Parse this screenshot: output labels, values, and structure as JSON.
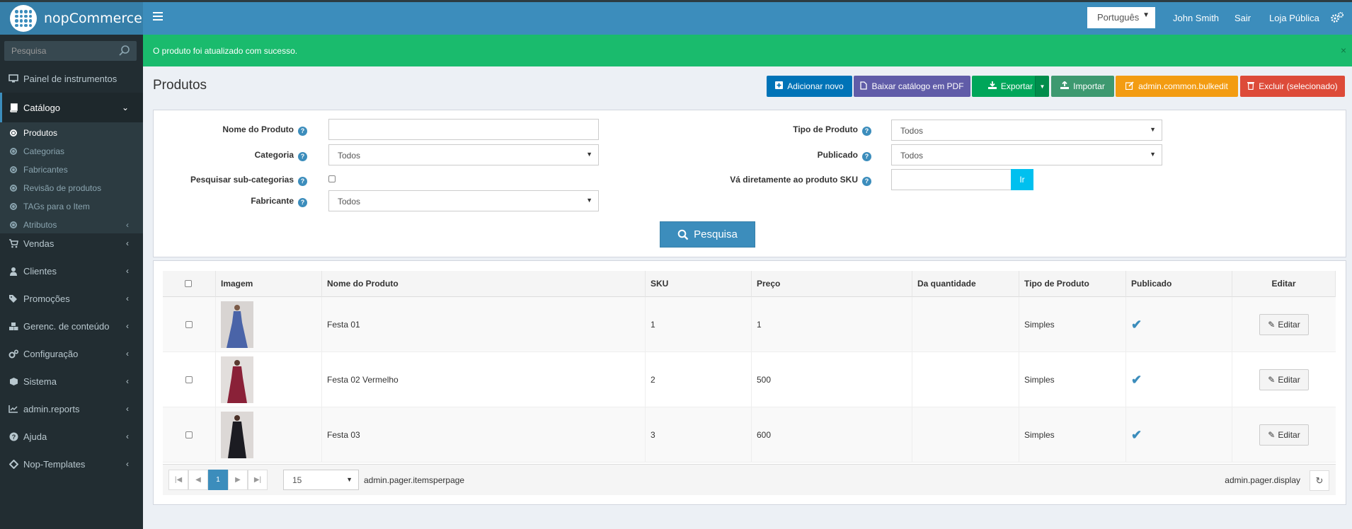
{
  "app": {
    "name": "nopCommerce"
  },
  "topbar": {
    "language": "Português",
    "user": "John Smith",
    "logout": "Sair",
    "store": "Loja Pública"
  },
  "sidebar": {
    "search_placeholder": "Pesquisa",
    "items": [
      {
        "label": "Painel de instrumentos",
        "icon": "desktop-icon"
      },
      {
        "label": "Catálogo",
        "icon": "book-icon"
      },
      {
        "label": "Vendas",
        "icon": "cart-icon"
      },
      {
        "label": "Clientes",
        "icon": "user-icon"
      },
      {
        "label": "Promoções",
        "icon": "tags-icon"
      },
      {
        "label": "Gerenc. de conteúdo",
        "icon": "cubes-icon"
      },
      {
        "label": "Configuração",
        "icon": "gears-icon"
      },
      {
        "label": "Sistema",
        "icon": "cube-icon"
      },
      {
        "label": "admin.reports",
        "icon": "line-chart-icon"
      },
      {
        "label": "Ajuda",
        "icon": "question-icon"
      },
      {
        "label": "Nop-Templates",
        "icon": "puzzle-icon"
      }
    ],
    "catalog_sub": [
      {
        "label": "Produtos"
      },
      {
        "label": "Categorias"
      },
      {
        "label": "Fabricantes"
      },
      {
        "label": "Revisão de produtos"
      },
      {
        "label": "TAGs para o Item"
      },
      {
        "label": "Atributos"
      }
    ]
  },
  "alert": {
    "message": "O produto foi atualizado com sucesso.",
    "close": "×"
  },
  "page": {
    "title": "Produtos"
  },
  "toolbar": {
    "add_new": "Adicionar novo",
    "download_pdf": "Baixar catálogo em PDF",
    "export": "Exportar",
    "import": "Importar",
    "bulkedit": "admin.common.bulkedit",
    "delete_selected": "Excluir (selecionado)"
  },
  "colors": {
    "primary": "#3c8dbc",
    "purple": "#605ca8",
    "green": "#00a65a",
    "teal": "#3d9970",
    "orange": "#f39c12",
    "red": "#dd4b39",
    "alert_green": "#1abb6d"
  },
  "filters": {
    "product_name_label": "Nome do Produto",
    "product_name_value": "",
    "category_label": "Categoria",
    "category_value": "Todos",
    "search_subcategories_label": "Pesquisar sub-categorias",
    "manufacturer_label": "Fabricante",
    "manufacturer_value": "Todos",
    "product_type_label": "Tipo de Produto",
    "product_type_value": "Todos",
    "published_label": "Publicado",
    "published_value": "Todos",
    "goto_sku_label": "Vá diretamente ao produto SKU",
    "goto_sku_value": "",
    "go_button": "Ir",
    "search_button": "Pesquisa"
  },
  "table": {
    "columns": [
      "Imagem",
      "Nome do Produto",
      "SKU",
      "Preço",
      "Da quantidade",
      "Tipo de Produto",
      "Publicado",
      "Editar"
    ],
    "rows": [
      {
        "name": "Festa 01",
        "sku": "1",
        "price": "1",
        "quantity": "",
        "type": "Simples",
        "published": true,
        "edit": "Editar",
        "dress_color": "#4a64a8"
      },
      {
        "name": "Festa 02 Vermelho",
        "sku": "2",
        "price": "500",
        "quantity": "",
        "type": "Simples",
        "published": true,
        "edit": "Editar",
        "dress_color": "#8a2138"
      },
      {
        "name": "Festa 03",
        "sku": "3",
        "price": "600",
        "quantity": "",
        "type": "Simples",
        "published": true,
        "edit": "Editar",
        "dress_color": "#1c1c22"
      }
    ]
  },
  "pager": {
    "current_page": "1",
    "items_per_page": "15",
    "items_per_page_label": "admin.pager.itemsperpage",
    "display": "admin.pager.display"
  }
}
